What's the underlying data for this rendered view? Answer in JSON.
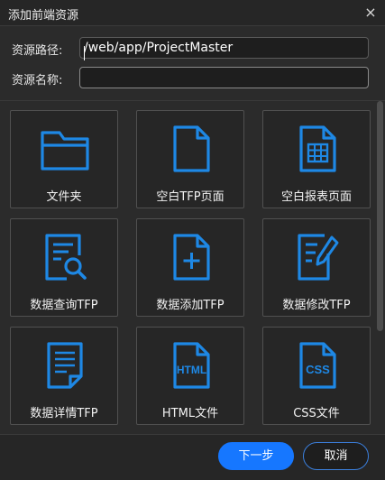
{
  "dialog": {
    "title": "添加前端资源",
    "close_glyph": "×"
  },
  "form": {
    "path_label": "资源路径:",
    "path_value": "/web/app/ProjectMaster",
    "name_label": "资源名称:",
    "name_value": ""
  },
  "tiles": [
    {
      "label": "文件夹",
      "icon": "folder-icon"
    },
    {
      "label": "空白TFP页面",
      "icon": "blank-page-icon"
    },
    {
      "label": "空白报表页面",
      "icon": "report-page-icon"
    },
    {
      "label": "数据查询TFP",
      "icon": "data-query-icon"
    },
    {
      "label": "数据添加TFP",
      "icon": "data-add-icon"
    },
    {
      "label": "数据修改TFP",
      "icon": "data-edit-icon"
    },
    {
      "label": "数据详情TFP",
      "icon": "data-detail-icon"
    },
    {
      "label": "HTML文件",
      "icon": "html-file-icon",
      "badge": "HTML"
    },
    {
      "label": "CSS文件",
      "icon": "css-file-icon",
      "badge": "CSS"
    }
  ],
  "footer": {
    "next_label": "下一步",
    "cancel_label": "取消"
  },
  "colors": {
    "accent": "#1677ff",
    "icon_blue": "#1e88e5",
    "background": "#2b2b2b",
    "tile_background": "#262626"
  }
}
